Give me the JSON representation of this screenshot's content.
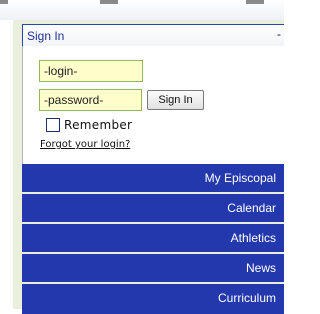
{
  "signin": {
    "header_title": "Sign In",
    "toggle_symbol": "-",
    "login_value": "-login-",
    "password_value": "-password-",
    "button_label": "Sign In",
    "remember_label": "Remember",
    "remember_checked": false,
    "forgot_link": "Forgot your login?"
  },
  "nav": {
    "items": [
      {
        "label": "My Episcopal"
      },
      {
        "label": "Calendar"
      },
      {
        "label": "Athletics"
      },
      {
        "label": "News"
      },
      {
        "label": "Curriculum"
      }
    ]
  },
  "colors": {
    "nav_background": "#2338ad",
    "field_background": "#ffffcc",
    "field_border": "#94b860",
    "header_text": "#1f2f96",
    "frame_background": "#e9eedd"
  }
}
